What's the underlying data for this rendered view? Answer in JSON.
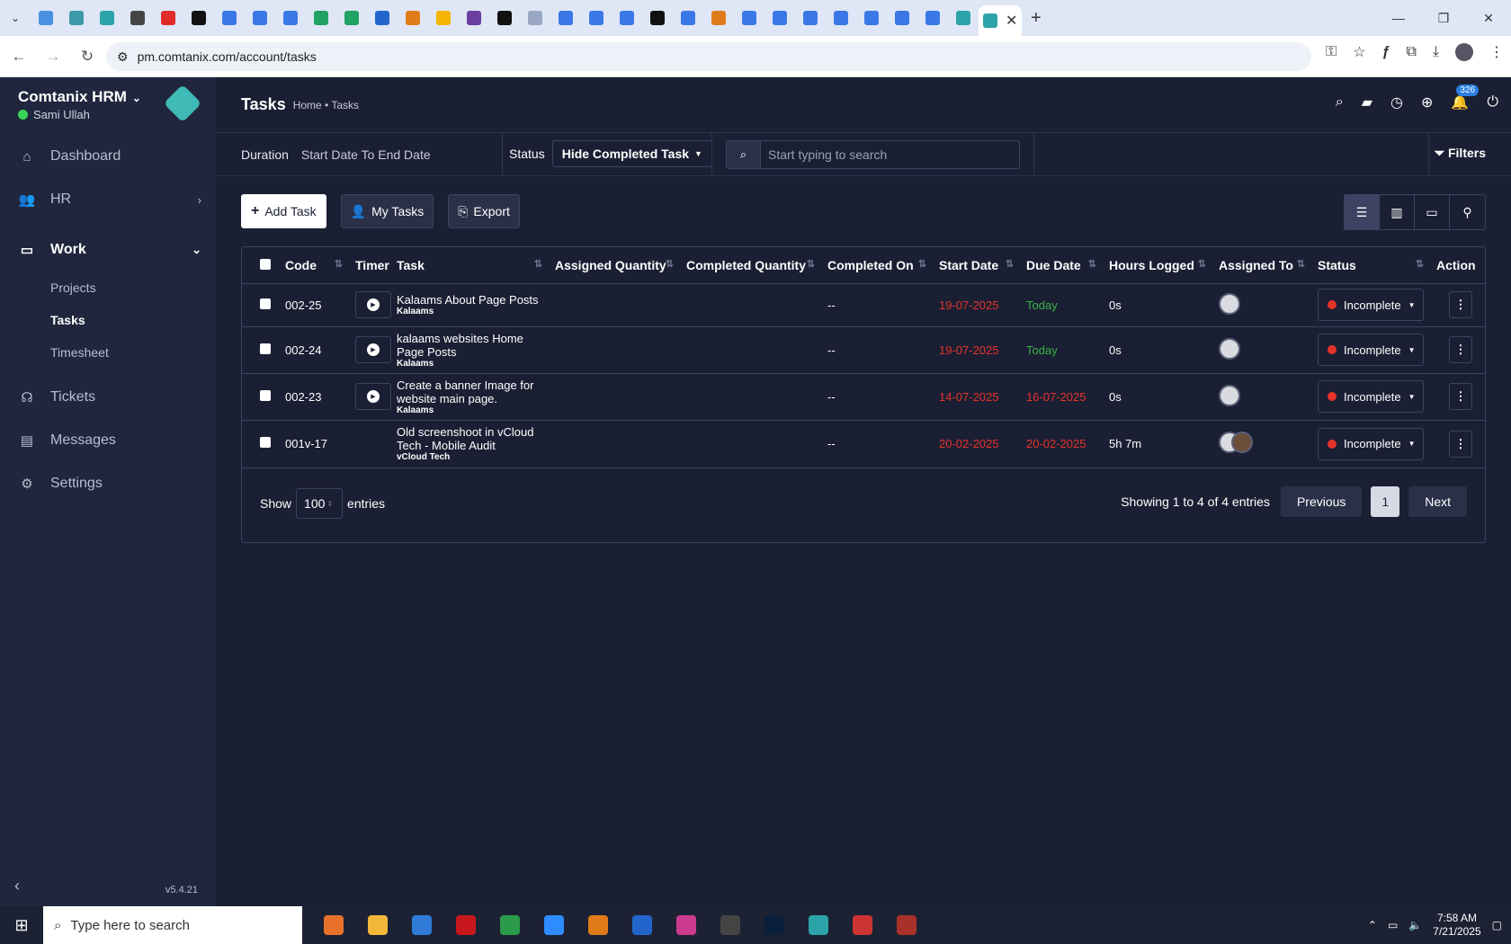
{
  "browser": {
    "url": "pm.comtanix.com/account/tasks",
    "tab_colors": [
      "#4a90e2",
      "#3c9aa8",
      "#2ba3a8",
      "#444",
      "#e02b2b",
      "#111",
      "#3b78e7",
      "#3b78e7",
      "#3b78e7",
      "#1ea362",
      "#1ea362",
      "#2266cc",
      "#e07b1a",
      "#f4b400",
      "#6b3fa0",
      "#111",
      "#9aa7c3",
      "#3b78e7",
      "#3b78e7",
      "#3b78e7",
      "#111",
      "#3b78e7",
      "#e07b1a",
      "#3b78e7",
      "#3b78e7",
      "#3b78e7",
      "#3b78e7",
      "#3b78e7",
      "#3b78e7",
      "#3b78e7",
      "#2ba3a8"
    ]
  },
  "sidebar": {
    "brand": "Comtanix HRM",
    "user": "Sami Ullah",
    "menu": {
      "dashboard": "Dashboard",
      "hr": "HR",
      "work": "Work",
      "tickets": "Tickets",
      "messages": "Messages",
      "settings": "Settings"
    },
    "work_sub": {
      "projects": "Projects",
      "tasks": "Tasks",
      "timesheet": "Timesheet"
    },
    "version": "v5.4.21"
  },
  "header": {
    "title": "Tasks",
    "breadcrumb": "Home • Tasks",
    "notification_count": "326"
  },
  "filterbar": {
    "duration_label": "Duration",
    "duration_value": "Start Date To End Date",
    "status_label": "Status",
    "status_value": "Hide Completed Task",
    "search_placeholder": "Start typing to search",
    "filters_label": "Filters"
  },
  "toolbar": {
    "add_task": "Add Task",
    "my_tasks": "My Tasks",
    "export": "Export"
  },
  "table": {
    "columns": [
      "Code",
      "Timer",
      "Task",
      "Assigned Quantity",
      "Completed Quantity",
      "Completed On",
      "Start Date",
      "Due Date",
      "Hours Logged",
      "Assigned To",
      "Status",
      "Action"
    ],
    "rows": [
      {
        "code": "002-25",
        "task": "Kalaams About Page Posts",
        "project": "Kalaams",
        "completed_on": "--",
        "start": "19-07-2025",
        "due": "Today",
        "hours": "0s",
        "status": "Incomplete"
      },
      {
        "code": "002-24",
        "task": "kalaams websites Home Page Posts",
        "project": "Kalaams",
        "completed_on": "--",
        "start": "19-07-2025",
        "due": "Today",
        "hours": "0s",
        "status": "Incomplete"
      },
      {
        "code": "002-23",
        "task": "Create a banner Image for website main page.",
        "project": "Kalaams",
        "completed_on": "--",
        "start": "14-07-2025",
        "due": "16-07-2025",
        "hours": "0s",
        "status": "Incomplete"
      },
      {
        "code": "001v-17",
        "task": "Old screenshoot in vCloud Tech - Mobile Audit",
        "project": "vCloud Tech",
        "completed_on": "--",
        "start": "20-02-2025",
        "due": "20-02-2025",
        "hours": "5h 7m",
        "status": "Incomplete"
      }
    ]
  },
  "pagination": {
    "show": "Show",
    "page_length": "100",
    "entries": "entries",
    "info": "Showing 1 to 4 of 4 entries",
    "previous": "Previous",
    "current": "1",
    "next": "Next"
  },
  "taskbar": {
    "search_placeholder": "Type here to search",
    "time": "7:58 AM",
    "date": "7/21/2025",
    "icon_colors": [
      "#e8702a",
      "#f3b73a",
      "#2f7bd6",
      "#c7161c",
      "#2b9a4a",
      "#2d8cff",
      "#e07b1a",
      "#2266cc",
      "#cc3a8f",
      "#444",
      "#0a1f3c",
      "#2ba3a8",
      "#cc3333",
      "#a8322a"
    ]
  }
}
